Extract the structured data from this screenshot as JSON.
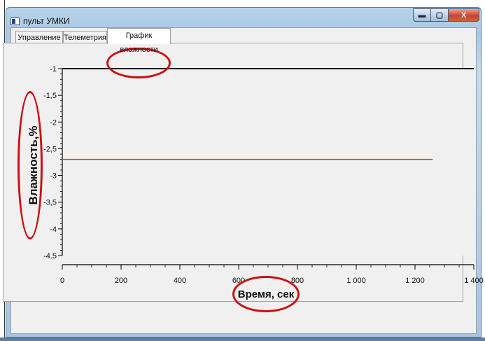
{
  "window": {
    "title": "пульт УМКИ",
    "controls": {
      "minimize": "▬",
      "maximize": "▢",
      "close": "X"
    }
  },
  "tabs": [
    {
      "label": "Управление",
      "active": false
    },
    {
      "label": "Телеметрия",
      "active": false
    },
    {
      "label": "График влажности",
      "active": true
    }
  ],
  "chart_data": {
    "type": "line",
    "ylabel": "Влажность,%",
    "xlabel": "Время, сек",
    "xlim": [
      0,
      1400
    ],
    "ylim": [
      -4.5,
      -1
    ],
    "y_ticks": [
      "-1",
      "-1,5",
      "-2",
      "-2,5",
      "-3",
      "-3,5",
      "-4",
      "-4.5"
    ],
    "x_ticks": [
      "0",
      "200",
      "400",
      "600",
      "800",
      "1 000",
      "1 200",
      "1 400"
    ],
    "series": [
      {
        "color": "#d03a2c",
        "x": [
          0,
          1260
        ],
        "y": [
          -2.7,
          -2.7
        ]
      }
    ],
    "grid": false
  },
  "colors": {
    "annotation": "#cc1111",
    "series": "#d03a2c"
  }
}
